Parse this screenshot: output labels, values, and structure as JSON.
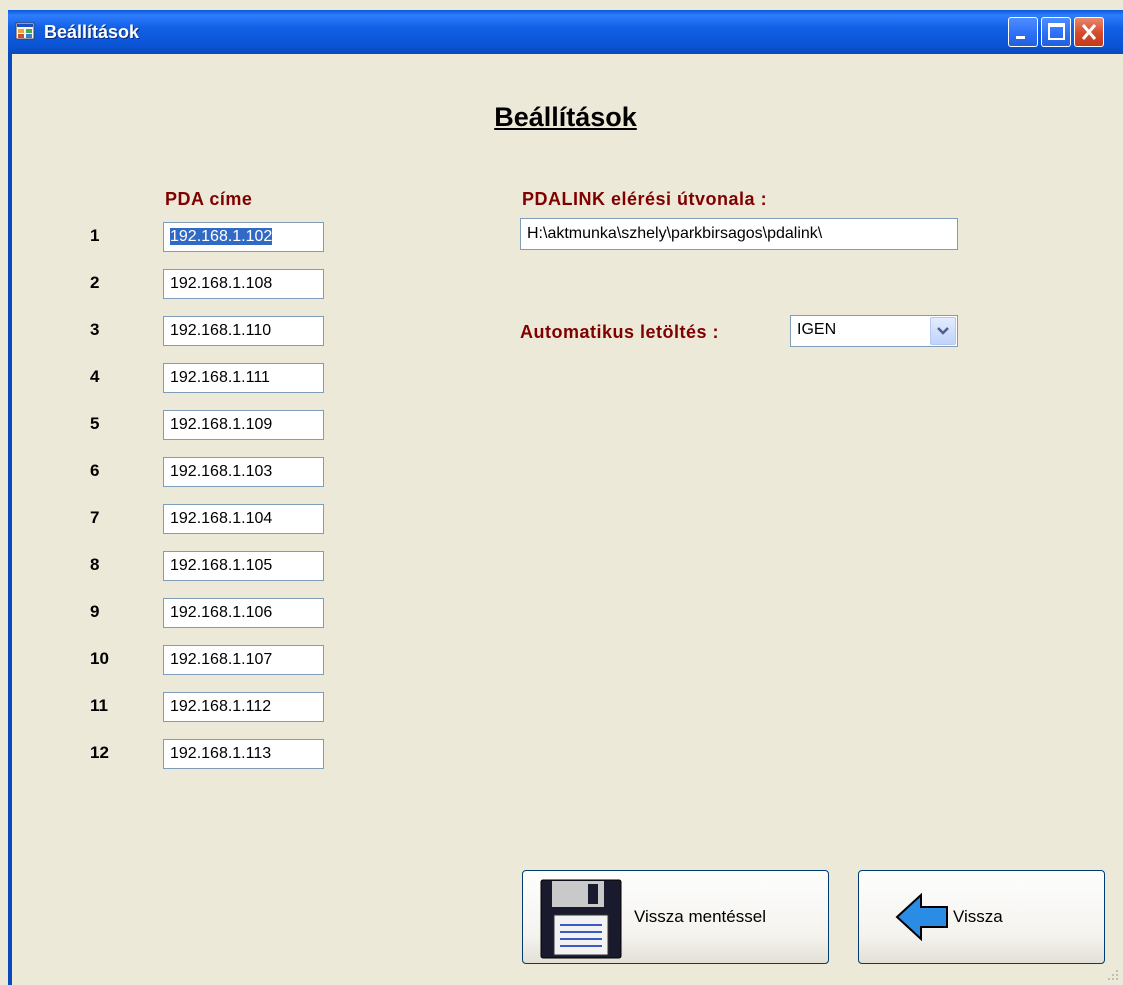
{
  "window": {
    "title": "Beállítások",
    "controls": [
      "minimize-icon",
      "maximize-icon",
      "close-icon"
    ]
  },
  "heading": "Beállítások",
  "pda": {
    "column_label": "PDA címe",
    "rows": [
      {
        "num": "1",
        "ip": "192.168.1.102",
        "selected": true
      },
      {
        "num": "2",
        "ip": "192.168.1.108"
      },
      {
        "num": "3",
        "ip": "192.168.1.110"
      },
      {
        "num": "4",
        "ip": "192.168.1.111"
      },
      {
        "num": "5",
        "ip": "192.168.1.109"
      },
      {
        "num": "6",
        "ip": "192.168.1.103"
      },
      {
        "num": "7",
        "ip": "192.168.1.104"
      },
      {
        "num": "8",
        "ip": "192.168.1.105"
      },
      {
        "num": "9",
        "ip": "192.168.1.106"
      },
      {
        "num": "10",
        "ip": "192.168.1.107"
      },
      {
        "num": "11",
        "ip": "192.168.1.112"
      },
      {
        "num": "12",
        "ip": "192.168.1.113"
      }
    ]
  },
  "pdalink": {
    "label": "PDALINK elérési útvonala :",
    "path": "H:\\aktmunka\\szhely\\parkbirsagos\\pdalink\\"
  },
  "auto_download": {
    "label": "Automatikus letöltés :",
    "selected": "IGEN"
  },
  "buttons": {
    "save_back": "Vissza mentéssel",
    "back": "Vissza"
  },
  "colors": {
    "title_bar": "#0a5ad8",
    "form_bg": "#ece9d8",
    "label_red": "#800000",
    "selection": "#316ac5"
  }
}
